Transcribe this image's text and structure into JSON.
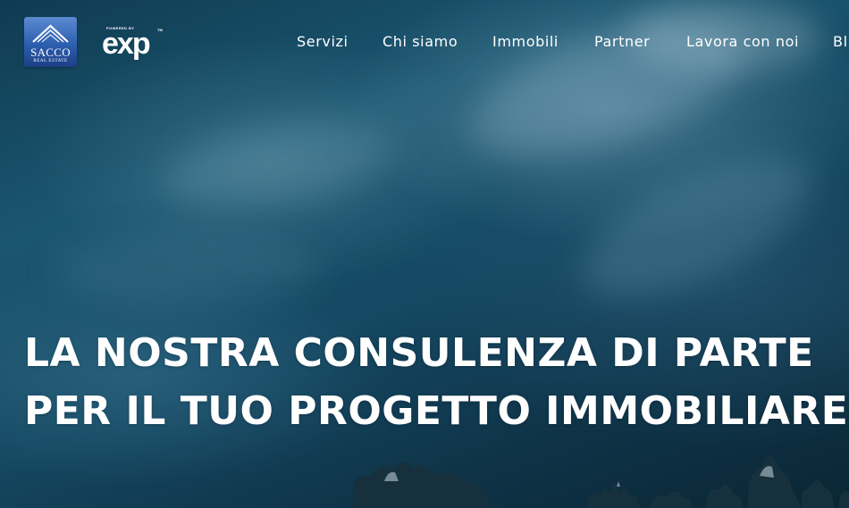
{
  "brand": {
    "logo_name": "SACCO",
    "logo_subtitle": "REAL ESTATE",
    "partner_powered_by": "POWERED BY",
    "partner_logo_text": "exp",
    "partner_trademark": "TM"
  },
  "nav": {
    "items": [
      {
        "label": "Servizi"
      },
      {
        "label": "Chi siamo"
      },
      {
        "label": "Immobili"
      },
      {
        "label": "Partner"
      },
      {
        "label": "Lavora con noi"
      },
      {
        "label": "Bl"
      }
    ]
  },
  "hero": {
    "headline_line1": "LA NOSTRA CONSULENZA DI PARTE",
    "headline_line2": "PER IL TUO PROGETTO IMMOBILIARE"
  },
  "colors": {
    "sky_dark": "#0e3246",
    "sky_mid": "#1b5670",
    "logo_blue": "#2d5fb0",
    "text": "#ffffff"
  }
}
